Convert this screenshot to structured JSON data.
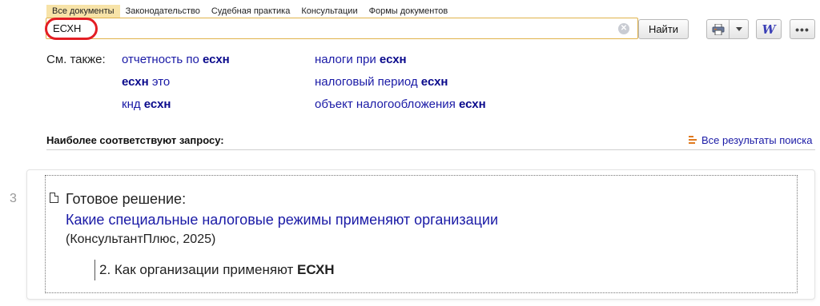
{
  "tabs": [
    {
      "label": "Все документы",
      "active": true
    },
    {
      "label": "Законодательство"
    },
    {
      "label": "Судебная практика"
    },
    {
      "label": "Консультации"
    },
    {
      "label": "Формы документов"
    }
  ],
  "search": {
    "value": "ЕСХН",
    "clear_icon": "clear-icon",
    "find_label": "Найти"
  },
  "toolbar": {
    "print_icon": "printer-icon",
    "word_icon": "W",
    "more_icon": "•••"
  },
  "see_also": {
    "label": "См. также:",
    "links": [
      {
        "pre": "отчетность по ",
        "bold": "есхн",
        "post": ""
      },
      {
        "pre": "",
        "bold": "есхн",
        "post": " это"
      },
      {
        "pre": "кнд ",
        "bold": "есхн",
        "post": ""
      },
      {
        "pre": "налоги при ",
        "bold": "есхн",
        "post": ""
      },
      {
        "pre": "налоговый период ",
        "bold": "есхн",
        "post": ""
      },
      {
        "pre": "объект налогообложения ",
        "bold": "есхн",
        "post": ""
      }
    ]
  },
  "best_match": {
    "title": "Наиболее соответствуют запросу:",
    "all_results": "Все результаты поиска"
  },
  "result": {
    "number": "3",
    "type": "Готовое решение:",
    "title": "Какие специальные налоговые режимы применяют организации",
    "source": "(КонсультантПлюс, 2025)",
    "section_pre": "2. Как организации применяют ",
    "section_bold": "ЕСХН"
  },
  "colors": {
    "accent_tab": "#f7e3a8",
    "link": "#1a1aa6",
    "highlight_ring": "#e31e24",
    "search_border": "#e0b24a"
  }
}
